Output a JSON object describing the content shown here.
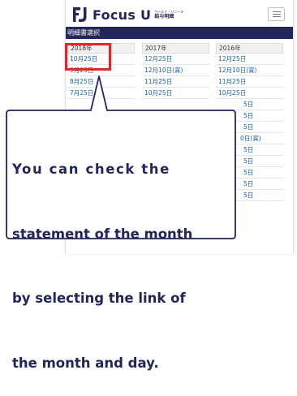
{
  "header": {
    "logo_text": "Focus U",
    "logo_sub_top": "ワールド・リソース",
    "logo_sub_bottom": "給与明細",
    "menu_icon": "hamburger-menu-icon"
  },
  "title_bar": {
    "label": "明細書選択"
  },
  "years": [
    {
      "label": "2018年",
      "links": [
        "10月25日",
        "9月25日",
        "8月25日",
        "7月25日"
      ]
    },
    {
      "label": "2017年",
      "links": [
        "12月25日",
        "12月10日(賞)",
        "11月25日",
        "10月25日"
      ]
    },
    {
      "label": "2016年",
      "links": [
        "12月25日",
        "12月10日(賞)",
        "11月25日",
        "10月25日",
        "5日",
        "5日",
        "5日",
        "0日(賞)",
        "5日",
        "5日",
        "5日",
        "5日",
        "5日"
      ]
    }
  ],
  "callout": {
    "lines": [
      "You can check the",
      "statement of the month",
      "by selecting the link of",
      "the month and day."
    ]
  },
  "colors": {
    "navy": "#232658",
    "link": "#1a5fae",
    "highlight_red": "#e3242b"
  }
}
